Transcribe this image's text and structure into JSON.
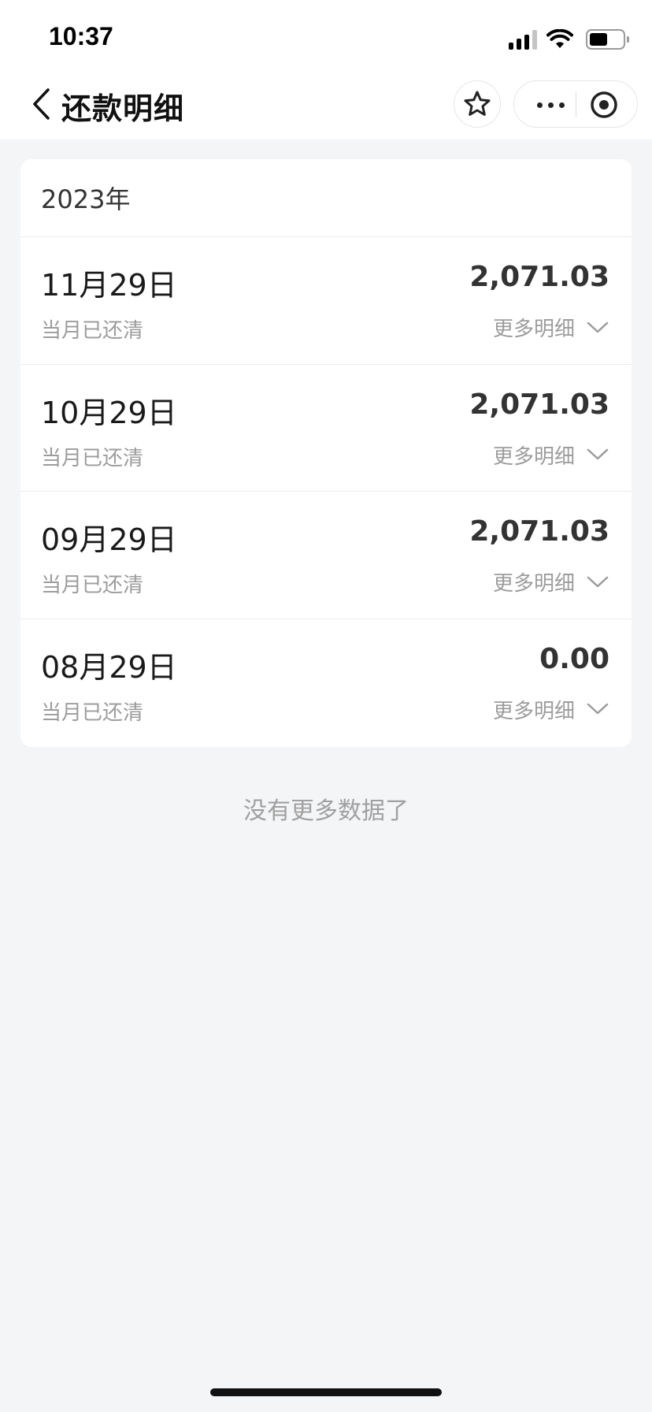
{
  "status_bar": {
    "time": "10:37"
  },
  "nav": {
    "title": "还款明细"
  },
  "list": {
    "year": "2023年",
    "rows": [
      {
        "date": "11月29日",
        "amount": "2,071.03",
        "status": "当月已还清",
        "detail_label": "更多明细"
      },
      {
        "date": "10月29日",
        "amount": "2,071.03",
        "status": "当月已还清",
        "detail_label": "更多明细"
      },
      {
        "date": "09月29日",
        "amount": "2,071.03",
        "status": "当月已还清",
        "detail_label": "更多明细"
      },
      {
        "date": "08月29日",
        "amount": "0.00",
        "status": "当月已还清",
        "detail_label": "更多明细"
      }
    ]
  },
  "footer": {
    "no_more": "没有更多数据了"
  }
}
